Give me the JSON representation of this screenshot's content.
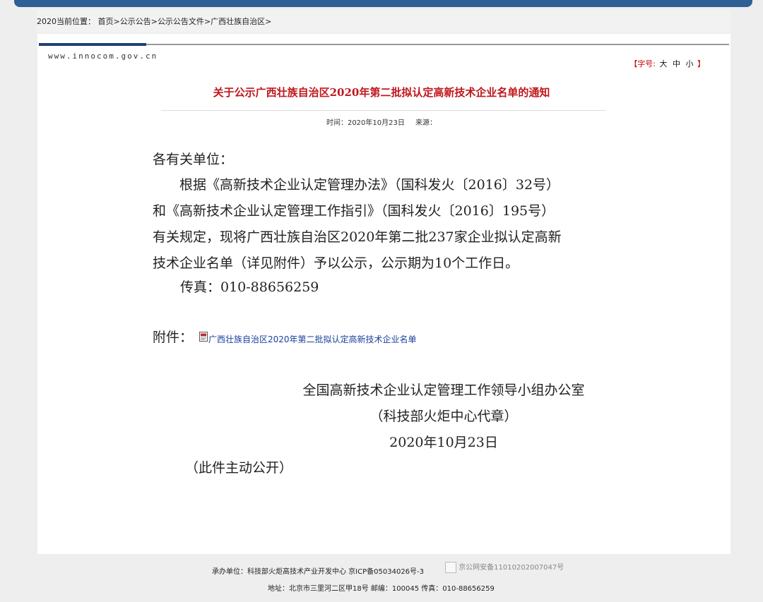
{
  "breadcrumb": {
    "prefix": "2020当前位置：",
    "items": [
      "首页",
      "公示公告",
      "公示公告文件",
      "广西壮族自治区"
    ],
    "sep": ">"
  },
  "site_url": "www.innocom.gov.cn",
  "font_size": {
    "open": "【字号:",
    "large": "大",
    "medium": "中",
    "small": "小",
    "close": "】"
  },
  "article": {
    "title": "关于公示广西壮族自治区2020年第二批拟认定高新技术企业名单的通知",
    "time_label": "时间：2020年10月23日",
    "source_label": "来源：",
    "greeting": "各有关单位：",
    "para_lines": [
      "根据《高新技术企业认定管理办法》（国科发火〔2016〕32号）",
      "和《高新技术企业认定管理工作指引》（国科发火〔2016〕195号）",
      "有关规定，现将广西壮族自治区2020年第二批237家企业拟认定高新",
      "技术企业名单（详见附件）予以公示，公示期为10个工作日。"
    ],
    "fax": "传真：010-88656259",
    "attachment_label": "附件：",
    "attachment_link": "广西壮族自治区2020年第二批拟认定高新技术企业名单",
    "signature_org": "全国高新技术企业认定管理工作领导小组办公室",
    "signature_seal": "（科技部火炬中心代章）",
    "signature_date": "2020年10月23日",
    "public_note": "（此件主动公开）"
  },
  "footer": {
    "line1": "承办单位：科技部火炬高技术产业开发中心  京ICP备05034026号-3",
    "police_alt": "京公网安备11010202007047号",
    "line2": "地址：北京市三里河二区甲18号  邮编：100045  传真：010-88656259"
  },
  "colors": {
    "title_red": "#c0161c",
    "link_blue": "#1a3f9c",
    "top_bar": "#2e5f95"
  },
  "icons": {
    "attachment": "pdf-file-icon",
    "police": "police-badge-icon"
  }
}
